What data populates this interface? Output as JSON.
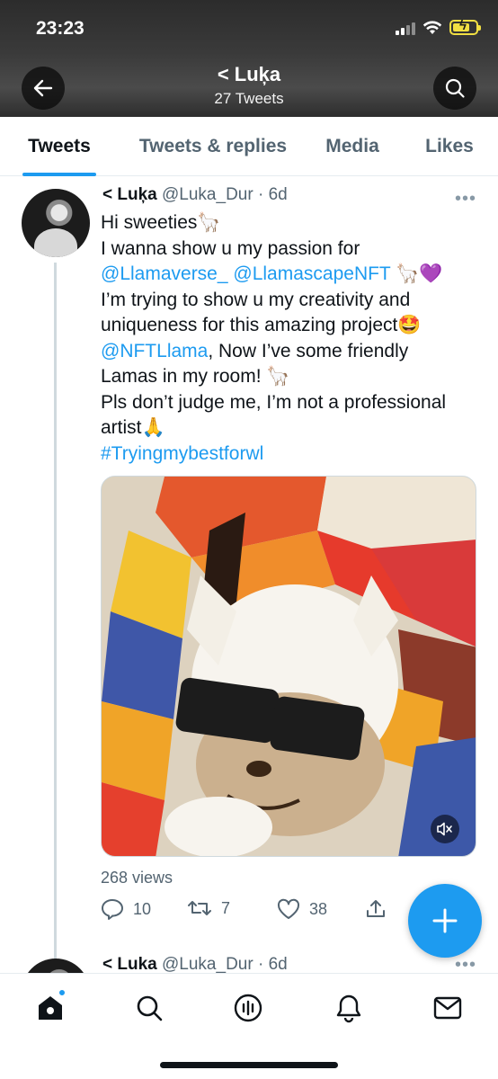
{
  "status_bar": {
    "time": "23:23"
  },
  "header": {
    "title": "< Luķa",
    "subtitle": "27 Tweets"
  },
  "tabs": [
    {
      "label": "Tweets",
      "active": true
    },
    {
      "label": "Tweets & replies",
      "active": false
    },
    {
      "label": "Media",
      "active": false
    },
    {
      "label": "Likes",
      "active": false
    }
  ],
  "tweet": {
    "author_name": "< Luķa",
    "handle": "@Luka_Dur",
    "time": "· 6d",
    "lines": {
      "l1": "Hi sweeties🦙",
      "l2": "I wanna show u my passion for",
      "l3_mention1": "@Llamaverse_",
      "l3_mention2": "@LlamascapeNFT",
      "l3_emoji": " 🦙💜",
      "l4": "I’m trying to show u my creativity and",
      "l5": "uniqueness for this amazing project🤩",
      "l6_mention": "@NFTLlama",
      "l6_rest": ", Now I’ve some friendly",
      "l7": "Lamas in my room! 🦙",
      "l8": "Pls don’t judge me, I’m not a professional",
      "l9": "artist🙏",
      "l10_hashtag": "#Tryingmybestforwl"
    },
    "views": "268 views",
    "replies": "10",
    "retweets": "7",
    "likes": "38"
  },
  "tweet2": {
    "author_name": "< Luka",
    "handle": "@Luka_Dur",
    "time": "· 6d"
  },
  "colors": {
    "accent": "#1d9bf0",
    "text": "#0f1419",
    "muted": "#536471"
  }
}
